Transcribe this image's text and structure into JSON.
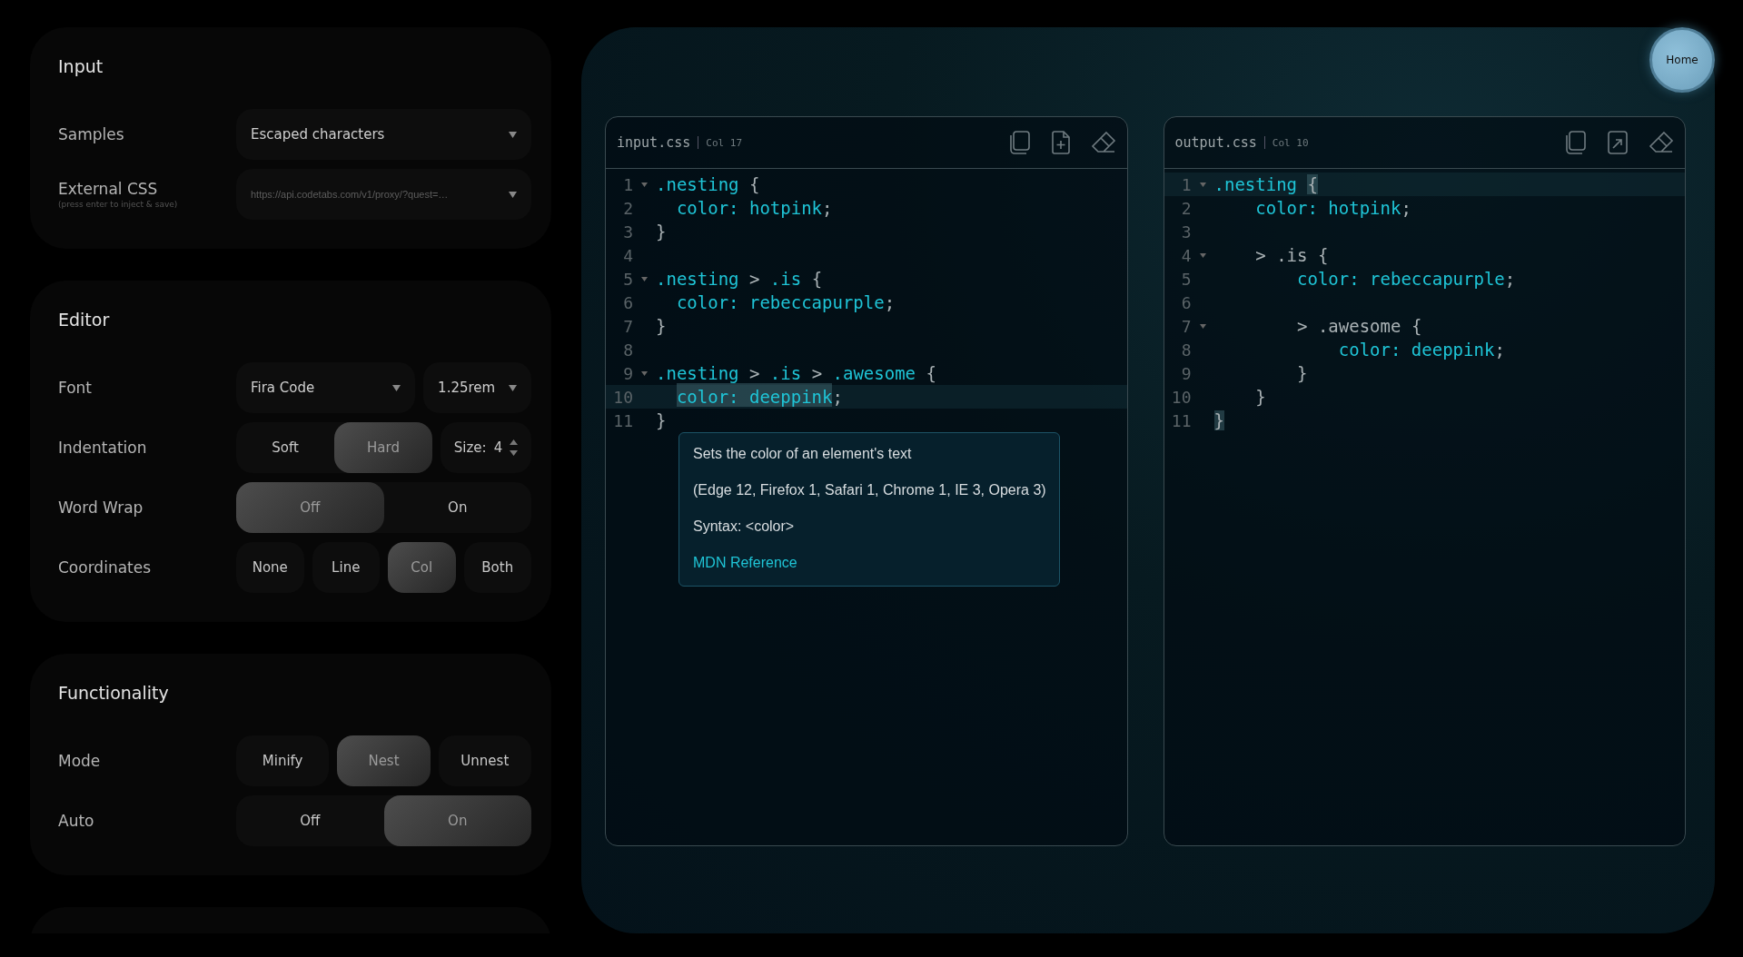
{
  "sections": [
    {
      "title": "Input",
      "rows": [
        {
          "label": "Samples",
          "controls": [
            {
              "kind": "select",
              "value": "Escaped characters"
            }
          ]
        },
        {
          "label": "External CSS",
          "hint": "(press enter to inject & save)",
          "controls": [
            {
              "kind": "url",
              "value": "https://api.codetabs.com/v1/proxy/?quest=…"
            }
          ]
        }
      ]
    },
    {
      "title": "Editor",
      "rows": [
        {
          "label": "Font",
          "controls": [
            {
              "kind": "select",
              "value": "Fira Code"
            },
            {
              "kind": "select",
              "value": "1.25rem"
            }
          ]
        },
        {
          "label": "Indentation",
          "controls": [
            {
              "kind": "segmented",
              "options": [
                {
                  "label": "Soft",
                  "selected": false
                },
                {
                  "label": "Hard",
                  "selected": true
                }
              ]
            },
            {
              "kind": "stepper",
              "label": "Size:",
              "value": "4"
            }
          ]
        },
        {
          "label": "Word Wrap",
          "controls": [
            {
              "kind": "segmented",
              "options": [
                {
                  "label": "Off",
                  "selected": true
                },
                {
                  "label": "On",
                  "selected": false
                }
              ]
            }
          ]
        },
        {
          "label": "Coordinates",
          "controls": [
            {
              "kind": "buttons",
              "options": [
                {
                  "label": "None",
                  "selected": false
                },
                {
                  "label": "Line",
                  "selected": false
                },
                {
                  "label": "Col",
                  "selected": true
                },
                {
                  "label": "Both",
                  "selected": false
                }
              ]
            }
          ]
        }
      ]
    },
    {
      "title": "Functionality",
      "rows": [
        {
          "label": "Mode",
          "controls": [
            {
              "kind": "buttons",
              "options": [
                {
                  "label": "Minify",
                  "selected": false
                },
                {
                  "label": "Nest",
                  "selected": true
                },
                {
                  "label": "Unnest",
                  "selected": false
                }
              ]
            }
          ]
        },
        {
          "label": "Auto",
          "controls": [
            {
              "kind": "segmented",
              "options": [
                {
                  "label": "Off",
                  "selected": false
                },
                {
                  "label": "On",
                  "selected": true
                }
              ]
            }
          ]
        }
      ]
    }
  ],
  "home_button": "Home",
  "editors": [
    {
      "kind": "input",
      "filename": "input.css",
      "status": "Col 17",
      "lines": [
        {
          "number": "1",
          "fold": true,
          "active": false,
          "tokens": [
            {
              "text": ".nesting",
              "kind": "code",
              "highlight": false
            },
            {
              "text": " {",
              "kind": "punct",
              "highlight": false
            }
          ]
        },
        {
          "number": "2",
          "fold": false,
          "active": false,
          "tokens": [
            {
              "text": "  color: hotpink",
              "kind": "code",
              "highlight": false
            },
            {
              "text": ";",
              "kind": "punct",
              "highlight": false
            }
          ]
        },
        {
          "number": "3",
          "fold": false,
          "active": false,
          "tokens": [
            {
              "text": "}",
              "kind": "punct",
              "highlight": false
            }
          ]
        },
        {
          "number": "4",
          "fold": false,
          "active": false
        },
        {
          "number": "5",
          "fold": true,
          "active": false,
          "tokens": [
            {
              "text": ".nesting",
              "kind": "code",
              "highlight": false
            },
            {
              "text": " > ",
              "kind": "punct",
              "highlight": false
            },
            {
              "text": ".is",
              "kind": "code",
              "highlight": false
            },
            {
              "text": " {",
              "kind": "punct",
              "highlight": false
            }
          ]
        },
        {
          "number": "6",
          "fold": false,
          "active": false,
          "tokens": [
            {
              "text": "  color: rebeccapurple",
              "kind": "code",
              "highlight": false
            },
            {
              "text": ";",
              "kind": "punct",
              "highlight": false
            }
          ]
        },
        {
          "number": "7",
          "fold": false,
          "active": false,
          "tokens": [
            {
              "text": "}",
              "kind": "punct",
              "highlight": false
            }
          ]
        },
        {
          "number": "8",
          "fold": false,
          "active": false
        },
        {
          "number": "9",
          "fold": true,
          "active": false,
          "tokens": [
            {
              "text": ".nesting",
              "kind": "code",
              "highlight": false
            },
            {
              "text": " > ",
              "kind": "punct",
              "highlight": false
            },
            {
              "text": ".is",
              "kind": "code",
              "highlight": false
            },
            {
              "text": " > ",
              "kind": "punct",
              "highlight": false
            },
            {
              "text": ".awesome",
              "kind": "code",
              "highlight": false
            },
            {
              "text": " {",
              "kind": "punct",
              "highlight": false
            }
          ]
        },
        {
          "number": "10",
          "fold": false,
          "active": true,
          "tokens": [
            {
              "text": "  color: ",
              "kind": "code",
              "highlight": true
            },
            {
              "text": "deeppink",
              "kind": "code",
              "highlight": true
            },
            {
              "text": ";",
              "kind": "punct",
              "highlight": false
            }
          ]
        },
        {
          "number": "11",
          "fold": false,
          "active": false,
          "tokens": [
            {
              "text": "}",
              "kind": "punct",
              "highlight": false
            }
          ]
        }
      ],
      "tooltip": {
        "description": "Sets the color of an element's text",
        "support": "(Edge 12, Firefox 1, Safari 1, Chrome 1, IE 3, Opera 3)",
        "syntax": "Syntax: <color>",
        "link": "MDN Reference"
      }
    },
    {
      "kind": "output",
      "filename": "output.css",
      "status": "Col 10",
      "lines": [
        {
          "number": "1",
          "fold": true,
          "active": true,
          "tokens": [
            {
              "text": ".nesting ",
              "kind": "code",
              "highlight": false
            },
            {
              "text": "{",
              "kind": "punct",
              "highlight": true
            }
          ]
        },
        {
          "number": "2",
          "fold": false,
          "active": false,
          "tokens": [
            {
              "text": "    color: hotpink",
              "kind": "code",
              "highlight": false
            },
            {
              "text": ";",
              "kind": "punct",
              "highlight": false
            }
          ]
        },
        {
          "number": "3",
          "fold": false,
          "active": false
        },
        {
          "number": "4",
          "fold": true,
          "active": false,
          "tokens": [
            {
              "text": "    > ",
              "kind": "punct",
              "highlight": false
            },
            {
              "text": ".is",
              "kind": "punct",
              "highlight": false
            },
            {
              "text": " {",
              "kind": "punct",
              "highlight": false
            }
          ]
        },
        {
          "number": "5",
          "fold": false,
          "active": false,
          "tokens": [
            {
              "text": "        color: rebeccapurple",
              "kind": "code",
              "highlight": false
            },
            {
              "text": ";",
              "kind": "punct",
              "highlight": false
            }
          ]
        },
        {
          "number": "6",
          "fold": false,
          "active": false
        },
        {
          "number": "7",
          "fold": true,
          "active": false,
          "tokens": [
            {
              "text": "        > ",
              "kind": "punct",
              "highlight": false
            },
            {
              "text": ".awesome",
              "kind": "punct",
              "highlight": false
            },
            {
              "text": " {",
              "kind": "punct",
              "highlight": false
            }
          ]
        },
        {
          "number": "8",
          "fold": false,
          "active": false,
          "tokens": [
            {
              "text": "            color: deeppink",
              "kind": "code",
              "highlight": false
            },
            {
              "text": ";",
              "kind": "punct",
              "highlight": false
            }
          ]
        },
        {
          "number": "9",
          "fold": false,
          "active": false,
          "tokens": [
            {
              "text": "        }",
              "kind": "punct",
              "highlight": false
            }
          ]
        },
        {
          "number": "10",
          "fold": false,
          "active": false,
          "tokens": [
            {
              "text": "    }",
              "kind": "punct",
              "highlight": false
            }
          ]
        },
        {
          "number": "11",
          "fold": false,
          "active": false,
          "tokens": [
            {
              "text": "}",
              "kind": "punct",
              "highlight": true
            }
          ]
        }
      ]
    }
  ]
}
